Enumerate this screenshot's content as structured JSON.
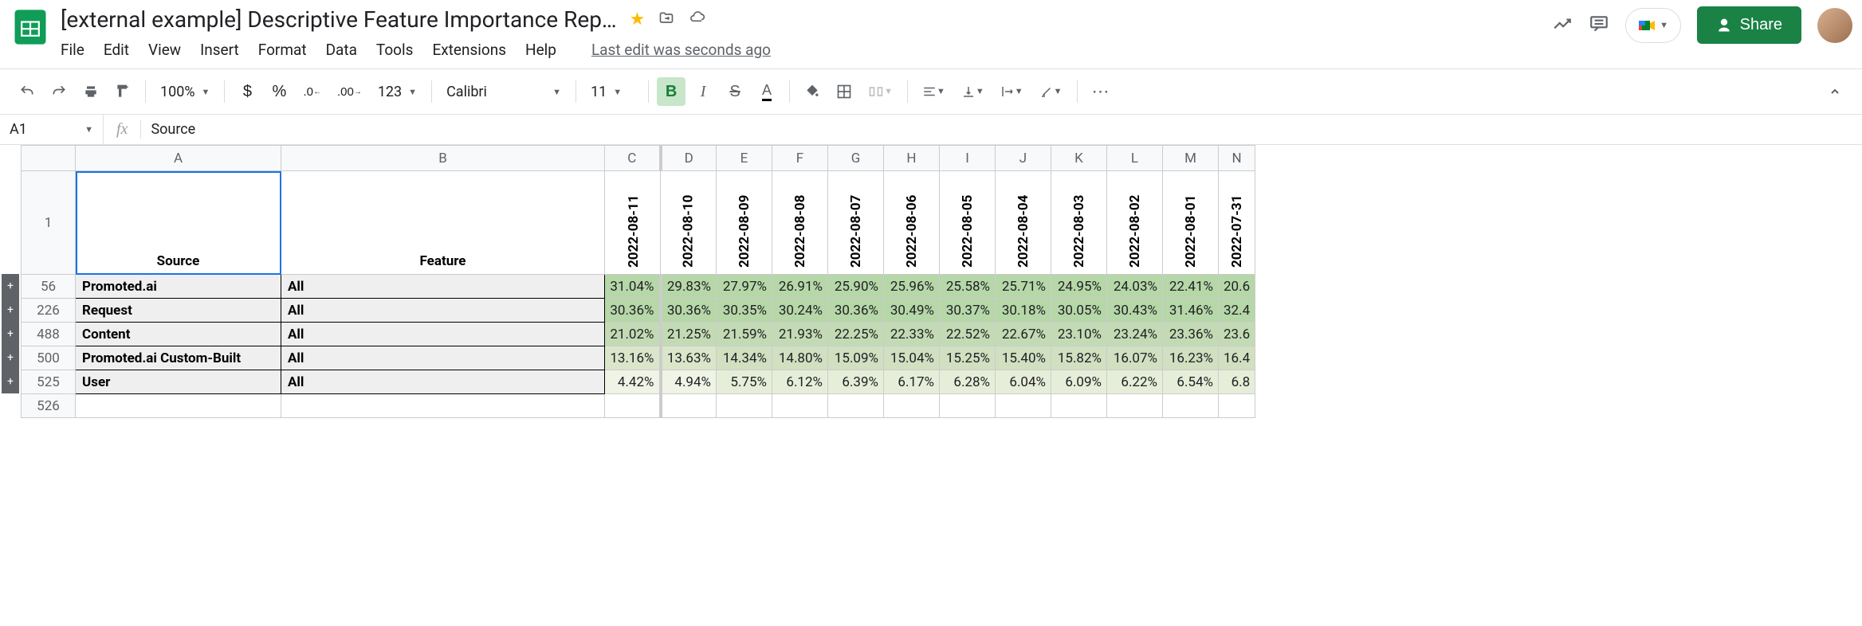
{
  "doc": {
    "title": "[external example] Descriptive Feature Importance Rep…",
    "last_edit": "Last edit was seconds ago"
  },
  "menu": {
    "file": "File",
    "edit": "Edit",
    "view": "View",
    "insert": "Insert",
    "format": "Format",
    "data": "Data",
    "tools": "Tools",
    "extensions": "Extensions",
    "help": "Help"
  },
  "share": {
    "label": "Share"
  },
  "toolbar": {
    "zoom": "100%",
    "font": "Calibri",
    "size": "11",
    "number_fmt": "123"
  },
  "name_box": {
    "cell": "A1",
    "value": "Source"
  },
  "columns": {
    "A": "A",
    "B": "B",
    "C": "C",
    "D": "D",
    "E": "E",
    "F": "F",
    "G": "G",
    "H": "H",
    "I": "I",
    "J": "J",
    "K": "K",
    "L": "L",
    "M": "M",
    "N": "N"
  },
  "row1": {
    "source": "Source",
    "feature": "Feature",
    "dates": [
      "2022-08-11",
      "2022-08-10",
      "2022-08-09",
      "2022-08-08",
      "2022-08-07",
      "2022-08-06",
      "2022-08-05",
      "2022-08-04",
      "2022-08-03",
      "2022-08-02",
      "2022-08-01",
      "2022-07-31"
    ]
  },
  "rows": [
    {
      "num": "56",
      "source": "Promoted.ai",
      "feature": "All",
      "v": [
        "31.04%",
        "29.83%",
        "27.97%",
        "26.91%",
        "25.90%",
        "25.96%",
        "25.58%",
        "25.71%",
        "24.95%",
        "24.03%",
        "22.41%",
        "20.6"
      ]
    },
    {
      "num": "226",
      "source": "Request",
      "feature": "All",
      "v": [
        "30.36%",
        "30.36%",
        "30.35%",
        "30.24%",
        "30.36%",
        "30.49%",
        "30.37%",
        "30.18%",
        "30.05%",
        "30.43%",
        "31.46%",
        "32.4"
      ]
    },
    {
      "num": "488",
      "source": "Content",
      "feature": "All",
      "v": [
        "21.02%",
        "21.25%",
        "21.59%",
        "21.93%",
        "22.25%",
        "22.33%",
        "22.52%",
        "22.67%",
        "23.10%",
        "23.24%",
        "23.36%",
        "23.6"
      ]
    },
    {
      "num": "500",
      "source": "Promoted.ai Custom-Built",
      "feature": "All",
      "v": [
        "13.16%",
        "13.63%",
        "14.34%",
        "14.80%",
        "15.09%",
        "15.04%",
        "15.25%",
        "15.40%",
        "15.82%",
        "16.07%",
        "16.23%",
        "16.4"
      ]
    },
    {
      "num": "525",
      "source": "User",
      "feature": "All",
      "v": [
        "4.42%",
        "4.94%",
        "5.75%",
        "6.12%",
        "6.39%",
        "6.17%",
        "6.28%",
        "6.04%",
        "6.09%",
        "6.22%",
        "6.54%",
        "6.8"
      ]
    }
  ],
  "last_row": "526",
  "shades_by_row": [
    [
      "shade-1",
      "shade-1",
      "shade-1",
      "shade-1",
      "shade-1",
      "shade-1",
      "shade-1",
      "shade-1",
      "shade-1",
      "shade-1",
      "shade-1",
      "shade-1"
    ],
    [
      "shade-1",
      "shade-1",
      "shade-1",
      "shade-1",
      "shade-1",
      "shade-1",
      "shade-1",
      "shade-1",
      "shade-1",
      "shade-1",
      "shade-1",
      "shade-1"
    ],
    [
      "shade-2",
      "shade-2",
      "shade-2",
      "shade-2",
      "shade-2",
      "shade-2",
      "shade-2",
      "shade-2",
      "shade-2",
      "shade-2",
      "shade-2",
      "shade-2"
    ],
    [
      "shade-4",
      "shade-4",
      "shade-3",
      "shade-3",
      "shade-3",
      "shade-3",
      "shade-3",
      "shade-3",
      "shade-3",
      "shade-3",
      "shade-3",
      "shade-3"
    ],
    [
      "shade-6",
      "shade-6",
      "shade-5",
      "shade-5",
      "shade-5",
      "shade-5",
      "shade-5",
      "shade-5",
      "shade-5",
      "shade-5",
      "shade-5",
      "shade-5"
    ]
  ]
}
